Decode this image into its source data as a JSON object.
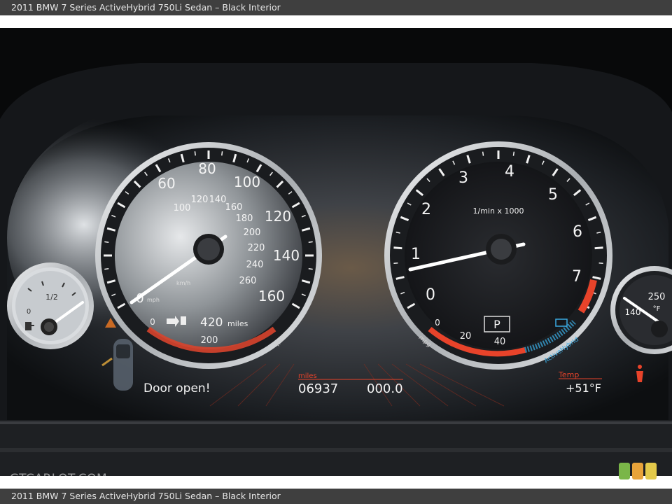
{
  "caption": {
    "top": "2011 BMW 7 Series ActiveHybrid 750Li Sedan – Black Interior",
    "bottom": "2011 BMW 7 Series ActiveHybrid 750Li Sedan – Black Interior"
  },
  "watermark": {
    "text": "GTCARLOT.COM",
    "squares": [
      "#7ab648",
      "#e8a33a",
      "#e3c94a"
    ]
  },
  "speedometer": {
    "mph_labels": [
      "60",
      "80",
      "100",
      "120",
      "140",
      "160"
    ],
    "kmh_labels": [
      "100",
      "120",
      "140",
      "160",
      "180",
      "200",
      "220",
      "240",
      "260"
    ],
    "unit_kmh": "km/h",
    "unit_mph": "mph",
    "zero_label": "0",
    "range_zero": "0",
    "range_mid": "200",
    "range_value": "420",
    "range_unit": "miles",
    "range_end_unit": "miles"
  },
  "fuel_gauge": {
    "half_label": "1/2",
    "zero_label": "0"
  },
  "tachometer": {
    "labels": [
      "0",
      "1",
      "2",
      "3",
      "4",
      "5",
      "6",
      "7"
    ],
    "unit": "1/min x 1000",
    "gear": "P",
    "mpg_labels": [
      "0",
      "20",
      "40"
    ],
    "mpg_unit": "mpg",
    "hybrid_label": "ActiveHybrid"
  },
  "oil_gauge": {
    "high_label": "250",
    "unit": "°F",
    "low_label": "140"
  },
  "status": {
    "door_message": "Door open!",
    "odometer_label": "miles",
    "odometer": "06937",
    "trip": "000.0",
    "temp_label": "Temp",
    "temp_value": "+51°F"
  },
  "colors": {
    "warning_red": "#e8432a",
    "hybrid_blue": "#3aa9e0",
    "bezel": "#c9cdd1"
  }
}
